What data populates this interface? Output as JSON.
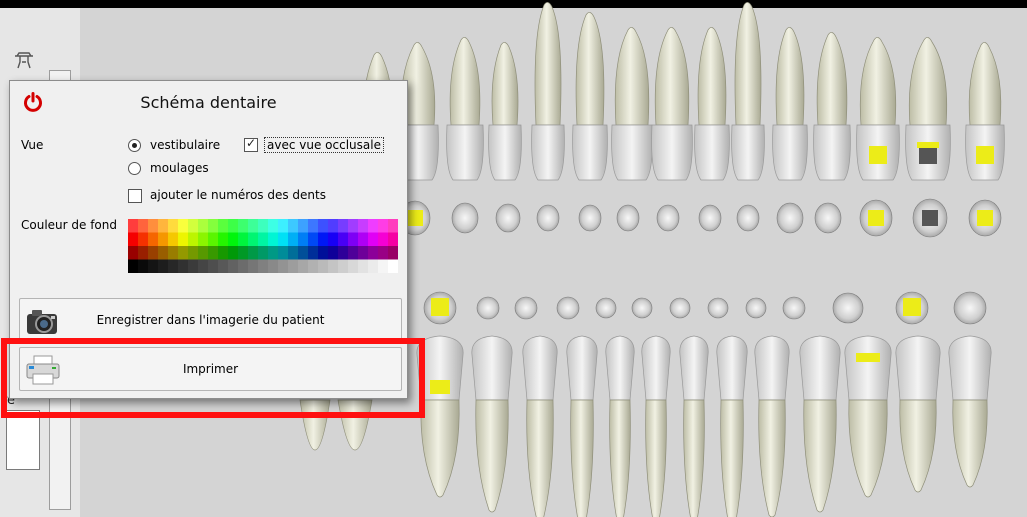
{
  "dialog": {
    "title": "Schéma dentaire",
    "vue_label": "Vue",
    "options": {
      "vestibulaire": {
        "label": "vestibulaire",
        "selected": true
      },
      "moulages": {
        "label": "moulages",
        "selected": false
      },
      "vue_occlusale": {
        "label": "avec vue occlusale",
        "checked": true
      },
      "numeros_dents": {
        "label": "ajouter le numéros des dents",
        "checked": false
      }
    },
    "couleur_label": "Couleur de fond",
    "buttons": {
      "enregistrer": "Enregistrer dans l'imagerie du patient",
      "imprimer": "Imprimer"
    }
  },
  "sidebar": {
    "fragment": "re"
  },
  "colors": {
    "chart_background": "#d4d4d4",
    "tooth": "#e3e3cf",
    "filling": "#ecec18",
    "highlight": "#ff1010",
    "power_icon": "#d40000"
  },
  "icons": [
    "tooth-tool-icon",
    "power-icon",
    "camera-icon",
    "printer-icon"
  ]
}
